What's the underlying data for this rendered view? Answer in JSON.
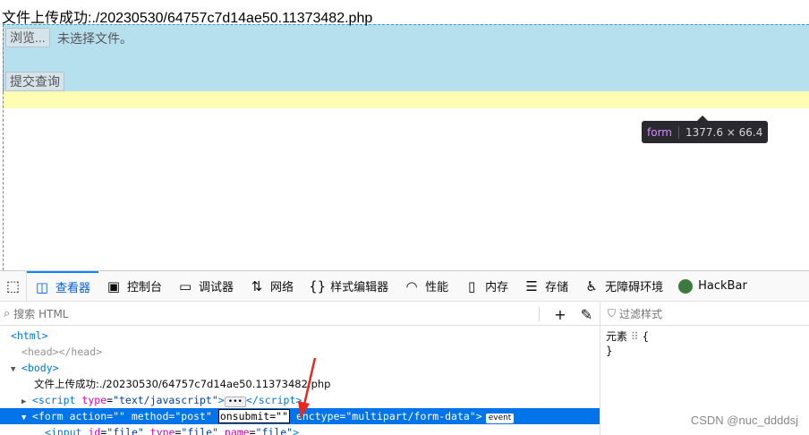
{
  "page": {
    "message": "文件上传成功:./20230530/64757c7d14ae50.11373482.php",
    "browse_label": "浏览...",
    "file_status": "未选择文件。",
    "submit_label": "提交查询",
    "tooltip_tag": "form",
    "tooltip_dims": "1377.6 × 66.4"
  },
  "devtools": {
    "tabs": [
      {
        "label": "查看器",
        "icon": "inspector-icon",
        "active": true
      },
      {
        "label": "控制台",
        "icon": "console-icon"
      },
      {
        "label": "调试器",
        "icon": "debugger-icon"
      },
      {
        "label": "网络",
        "icon": "network-icon"
      },
      {
        "label": "样式编辑器",
        "icon": "style-editor-icon"
      },
      {
        "label": "性能",
        "icon": "performance-icon"
      },
      {
        "label": "内存",
        "icon": "memory-icon"
      },
      {
        "label": "存储",
        "icon": "storage-icon"
      },
      {
        "label": "无障碍环境",
        "icon": "accessibility-icon"
      },
      {
        "label": "HackBar",
        "icon": "hackbar-icon"
      }
    ],
    "search_placeholder": "搜索 HTML",
    "filter_placeholder": "过滤样式",
    "rules": {
      "selector": "元素",
      "open": "{",
      "close": "}"
    },
    "tree": {
      "html": "html",
      "head": "head",
      "body": "body",
      "text_node": "文件上传成功:./20230530/64757c7d14ae50.11373482.php",
      "script_tag": "script",
      "script_type_attr": "type",
      "script_type_val": "\"text/javascript\"",
      "form_tag": "form",
      "form_action_attr": "action",
      "form_action_val": "\"\"",
      "form_method_attr": "method",
      "form_method_val": "\"post\"",
      "form_onsubmit_attr": "onsubmit",
      "form_onsubmit_val": "\"\"",
      "form_enctype_attr": "enctype",
      "form_enctype_val": "\"multipart/form-data\"",
      "event_badge": "event",
      "input_tag": "input",
      "input_id_attr": "id",
      "input_id_val": "\"file\"",
      "input_type_attr": "type",
      "input_type_val": "\"file\"",
      "input_name_attr": "name",
      "input_name_val": "\"file\""
    }
  },
  "watermark": "CSDN @nuc_ddddsj",
  "colors": {
    "form_highlight": "#b7e0ef",
    "margin_highlight": "#fdfdb3",
    "selected_row": "#0074e8",
    "annotation_arrow": "#e8281e"
  }
}
